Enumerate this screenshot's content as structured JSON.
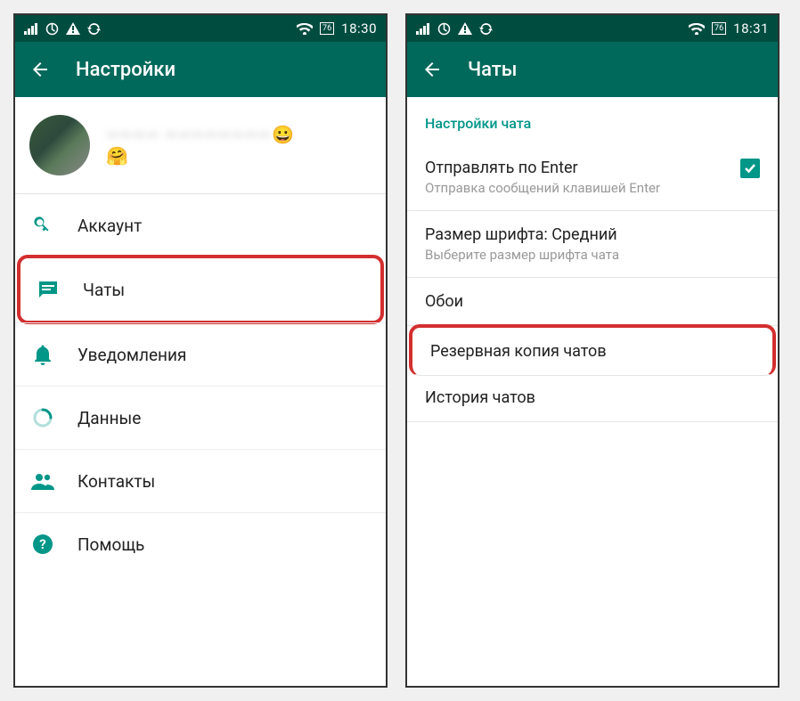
{
  "left": {
    "statusbar": {
      "battery": "76",
      "time": "18:30"
    },
    "appbar": {
      "title": "Настройки"
    },
    "profile": {
      "name_hidden": "———— ————————",
      "emoji1": "😀",
      "emoji2": "🤗"
    },
    "menu": {
      "account": "Аккаунт",
      "chats": "Чаты",
      "notifications": "Уведомления",
      "data": "Данные",
      "contacts": "Контакты",
      "help": "Помощь"
    }
  },
  "right": {
    "statusbar": {
      "battery": "76",
      "time": "18:31"
    },
    "appbar": {
      "title": "Чаты"
    },
    "section_header": "Настройки чата",
    "enter_send": {
      "title": "Отправлять по Enter",
      "sub": "Отправка сообщений клавишей Enter",
      "checked": true
    },
    "font_size": {
      "title": "Размер шрифта: Средний",
      "sub": "Выберите размер шрифта чата"
    },
    "wallpaper": {
      "title": "Обои"
    },
    "backup": {
      "title": "Резервная копия чатов"
    },
    "history": {
      "title": "История чатов"
    }
  }
}
